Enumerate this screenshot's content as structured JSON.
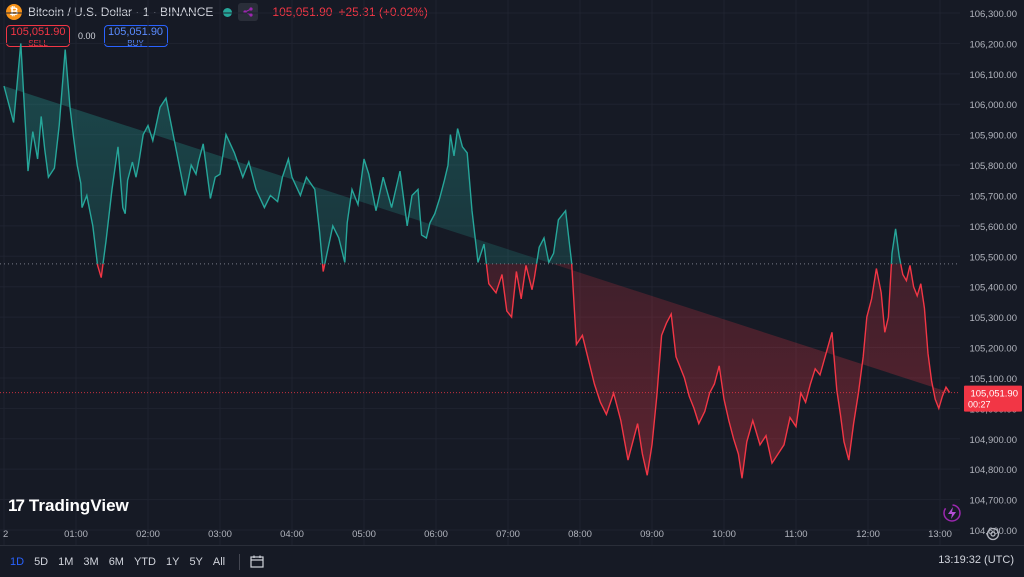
{
  "header": {
    "title": "Bitcoin / U.S. Dollar · 1 · BINANCE",
    "last_price": "105,051.90",
    "change": "+25.31 (+0.02%)"
  },
  "trade": {
    "sell_price": "105,051.90",
    "sell_label": "SELL",
    "spread": "0.00",
    "buy_price": "105,051.90",
    "buy_label": "BUY"
  },
  "logo_text": "TradingView",
  "timeframes": [
    "1D",
    "5D",
    "1M",
    "3M",
    "6M",
    "YTD",
    "1Y",
    "5Y",
    "All"
  ],
  "active_timeframe": "1D",
  "clock": "13:19:32 (UTC)",
  "colors": {
    "up": "#26a69a",
    "down": "#f23645",
    "bg": "#161a25",
    "grid": "#1f2330"
  },
  "icons": [
    "bitcoin-icon",
    "status-dot-icon",
    "indicator-icon",
    "calendar-icon",
    "settings-icon",
    "bolt-icon"
  ],
  "chart_data": {
    "type": "area",
    "title": "Bitcoin / U.S. Dollar · 1 · BINANCE",
    "baseline_price": 105475,
    "current_price": 105051.9,
    "current_price_label": "105,051.90",
    "countdown": "00:27",
    "ylim": [
      104600,
      106300
    ],
    "y_ticks": [
      104600,
      104700,
      104800,
      104900,
      105000,
      105100,
      105200,
      105300,
      105400,
      105500,
      105600,
      105700,
      105800,
      105900,
      106000,
      106100,
      106200,
      106300
    ],
    "y_tick_labels": [
      "104,600.00",
      "104,700.00",
      "104,800.00",
      "104,900.00",
      "105,000.00",
      "105,100.00",
      "105,200.00",
      "105,300.00",
      "105,400.00",
      "105,500.00",
      "105,600.00",
      "105,700.00",
      "105,800.00",
      "105,900.00",
      "106,000.00",
      "106,100.00",
      "106,200.00",
      "106,300.00"
    ],
    "xlim": [
      0,
      800
    ],
    "x_ticks": [
      0,
      60,
      120,
      180,
      240,
      300,
      360,
      420,
      480,
      540,
      600,
      660,
      720,
      780
    ],
    "x_tick_labels": [
      "2",
      "01:00",
      "02:00",
      "03:00",
      "04:00",
      "05:00",
      "06:00",
      "07:00",
      "08:00",
      "09:00",
      "10:00",
      "11:00",
      "12:00",
      "13:00"
    ],
    "x_minutes": [
      0,
      8,
      14,
      17,
      20,
      24,
      28,
      31,
      34,
      37,
      42,
      46,
      51,
      55,
      58,
      61,
      64,
      65,
      69,
      74,
      78,
      81,
      85,
      90,
      95,
      99,
      101,
      103,
      107,
      110,
      112,
      116,
      120,
      124,
      130,
      135,
      140,
      146,
      151,
      156,
      160,
      162,
      166,
      172,
      176,
      180,
      185,
      192,
      199,
      204,
      210,
      217,
      222,
      228,
      232,
      237,
      240,
      247,
      252,
      259,
      263,
      266,
      274,
      279,
      284,
      286,
      290,
      295,
      300,
      304,
      310,
      316,
      323,
      330,
      336,
      340,
      345,
      348,
      352,
      355,
      359,
      363,
      367,
      370,
      372,
      375,
      378,
      382,
      386,
      390,
      395,
      400,
      404,
      410,
      415,
      419,
      423,
      427,
      431,
      435,
      440,
      442,
      446,
      450,
      454,
      458,
      462,
      468,
      473,
      477,
      482,
      487,
      492,
      497,
      502,
      508,
      514,
      520,
      524,
      528,
      532,
      536,
      540,
      544,
      548,
      552,
      556,
      560,
      563,
      567,
      571,
      575,
      579,
      584,
      588,
      592,
      596,
      600,
      604,
      608,
      612,
      615,
      619,
      624,
      630,
      635,
      640,
      645,
      650,
      655,
      660,
      664,
      668,
      672,
      676,
      680,
      685,
      690,
      694,
      697,
      700,
      704,
      708,
      712,
      716,
      719,
      723,
      727,
      731,
      734,
      737,
      740,
      743,
      746,
      749,
      752,
      755,
      758,
      761,
      764,
      767,
      770,
      773,
      776,
      779,
      782,
      785,
      788,
      791,
      794
    ],
    "values": [
      106060,
      105940,
      106200,
      105990,
      105780,
      105910,
      105820,
      105960,
      105850,
      105760,
      105790,
      105930,
      106180,
      105990,
      105890,
      105800,
      105740,
      105660,
      105700,
      105600,
      105470,
      105430,
      105550,
      105720,
      105860,
      105660,
      105640,
      105750,
      105810,
      105760,
      105800,
      105900,
      105930,
      105880,
      105990,
      106020,
      105920,
      105800,
      105700,
      105800,
      105770,
      105810,
      105870,
      105690,
      105760,
      105770,
      105900,
      105840,
      105760,
      105810,
      105720,
      105660,
      105700,
      105680,
      105760,
      105820,
      105760,
      105700,
      105760,
      105720,
      105580,
      105450,
      105600,
      105560,
      105480,
      105610,
      105720,
      105670,
      105820,
      105770,
      105650,
      105760,
      105660,
      105780,
      105600,
      105700,
      105720,
      105570,
      105560,
      105610,
      105640,
      105690,
      105750,
      105800,
      105900,
      105830,
      105920,
      105860,
      105840,
      105650,
      105480,
      105540,
      105410,
      105380,
      105440,
      105320,
      105300,
      105450,
      105360,
      105470,
      105390,
      105430,
      105530,
      105560,
      105480,
      105510,
      105620,
      105650,
      105480,
      105210,
      105240,
      105160,
      105080,
      105020,
      104980,
      105050,
      104960,
      104830,
      104890,
      104950,
      104850,
      104780,
      104880,
      105040,
      105240,
      105280,
      105310,
      105170,
      105140,
      105100,
      105040,
      105000,
      104950,
      104990,
      105050,
      105080,
      105140,
      105030,
      104960,
      104900,
      104850,
      104770,
      104890,
      104960,
      104880,
      104910,
      104820,
      104850,
      104880,
      104970,
      104940,
      105050,
      105020,
      105080,
      105130,
      105110,
      105180,
      105250,
      105060,
      104980,
      104890,
      104830,
      104950,
      105050,
      105170,
      105300,
      105360,
      105460,
      105380,
      105250,
      105300,
      105510,
      105590,
      105500,
      105440,
      105420,
      105470,
      105400,
      105370,
      105410,
      105330,
      105180,
      105090,
      105030,
      105000,
      105040,
      105070,
      105052
    ]
  }
}
